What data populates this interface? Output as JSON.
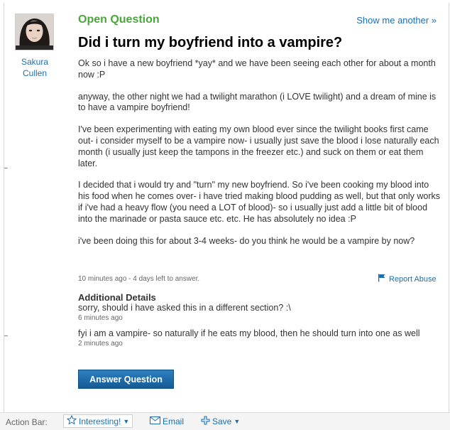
{
  "asker": {
    "name": "Sakura Cullen"
  },
  "header": {
    "type_label": "Open Question",
    "show_another": "Show me another »"
  },
  "question": {
    "title": "Did i turn my boyfriend into a vampire?",
    "paragraphs": [
      "Ok so i have a new boyfriend *yay* and we have been seeing each other for about a month now :P",
      "anyway, the other night we had a twilight marathon (i LOVE twilight) and a dream of mine is to have a vampire boyfriend!",
      "I've been experimenting with eating my own blood ever since the twilight books first came out- i consider myself to be a vampire now- i usually just save the blood i lose naturally each month (i usually just keep the tampons in the freezer etc.) and suck on them or eat them later.",
      "I decided that i would try and \"turn\" my new boyfriend. So i've been cooking my blood into his food when he comes over- i have tried making blood pudding as well, but that only works if i've had a heavy flow (you need a LOT of blood)- so i usually just add a little bit of blood into the marinade or pasta sauce etc. etc. He has absolutely no idea :P",
      "i've been doing this for about 3-4 weeks- do you think he would be a vampire by now?"
    ],
    "meta": "10 minutes ago - 4 days left to answer.",
    "report_abuse": "Report Abuse"
  },
  "details": {
    "heading": "Additional Details",
    "items": [
      {
        "text": "sorry, should i have asked this in a different section? :\\",
        "time": "6 minutes ago"
      },
      {
        "text": "fyi i am a vampire- so naturally if he eats my blood, then he should turn into one as well",
        "time": "2 minutes ago"
      }
    ]
  },
  "answer_button": "Answer Question",
  "action_bar": {
    "label": "Action Bar:",
    "interesting": "Interesting!",
    "email": "Email",
    "save": "Save"
  },
  "colors": {
    "accent_green": "#4ba63c",
    "link_blue": "#1a6fb4",
    "button_blue": "#135b96"
  },
  "icons": [
    "star-icon",
    "envelope-icon",
    "plus-icon",
    "flag-icon",
    "caret-down-icon"
  ]
}
